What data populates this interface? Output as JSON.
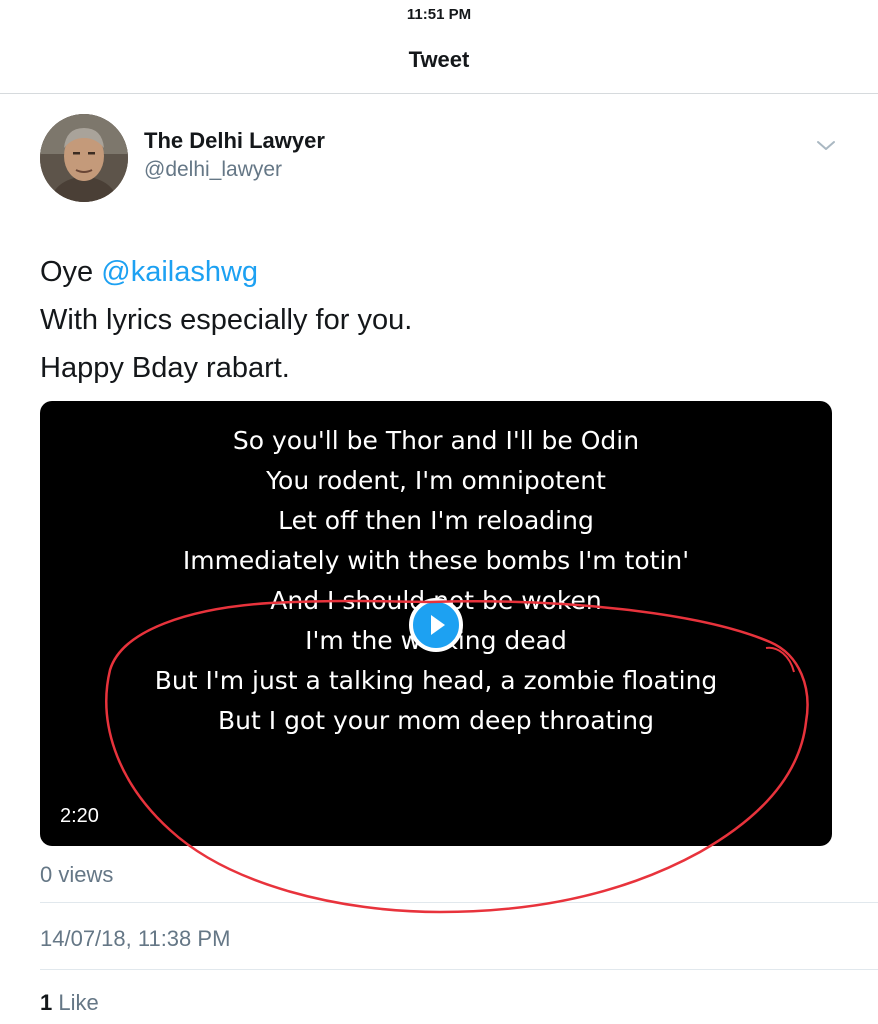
{
  "status_bar": {
    "time": "11:51 PM"
  },
  "nav": {
    "title": "Tweet"
  },
  "author": {
    "display_name": "The Delhi Lawyer",
    "username": "@delhi_lawyer"
  },
  "tweet": {
    "line1_prefix": "Oye ",
    "mention": "@kailashwg",
    "line2": "With lyrics especially for you.",
    "line3": "Happy Bday rabart."
  },
  "video": {
    "lyrics": [
      "So you'll be Thor and I'll be Odin",
      "You rodent, I'm omnipotent",
      "Let off then I'm reloading",
      "Immediately with these bombs I'm totin'",
      "And I should not be woken",
      "I'm the walking dead",
      "But I'm just a talking head, a zombie floating",
      "But I got your mom deep throating"
    ],
    "duration": "2:20"
  },
  "stats": {
    "views": "0 views",
    "timestamp": "14/07/18, 11:38 PM",
    "likes_count": "1",
    "likes_label": "Like"
  },
  "colors": {
    "accent": "#1da1f2",
    "annotation": "#e8333c",
    "secondary_text": "#657786"
  },
  "icons": {
    "more": "chevron-down-icon",
    "play": "play-icon"
  }
}
